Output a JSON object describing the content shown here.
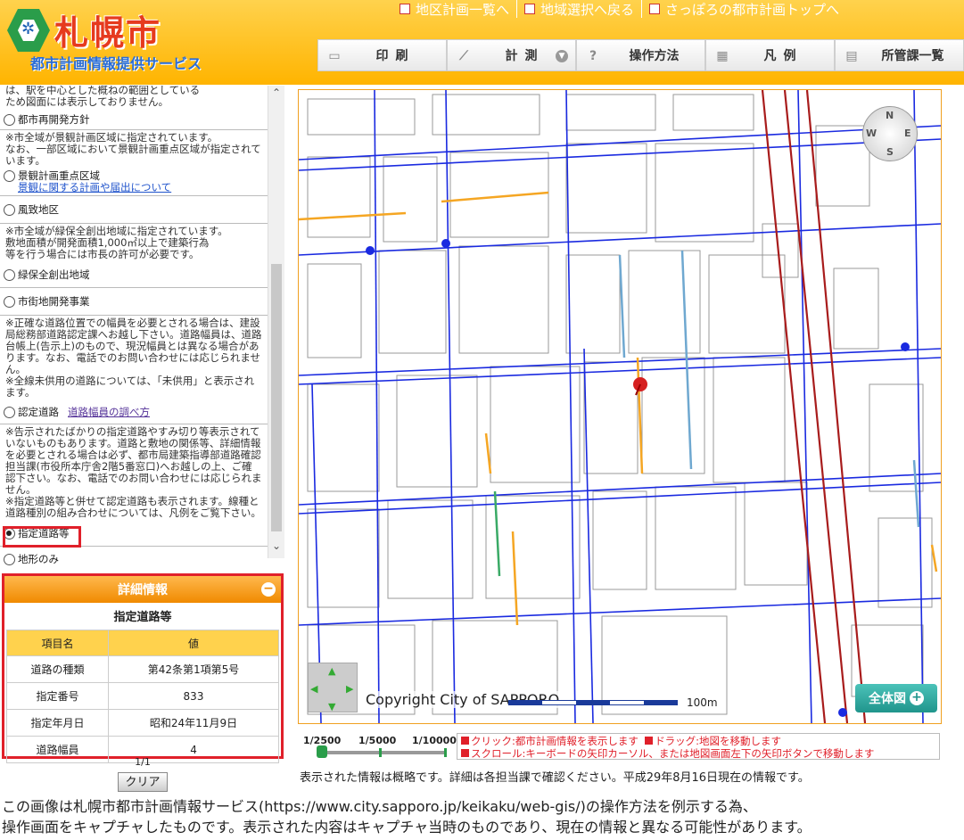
{
  "header": {
    "logo_name": "札幌市",
    "logo_sub": "都市計画情報提供サービス",
    "top_links": [
      "地区計画一覧へ",
      "地域選択へ戻る",
      "さっぽろの都市計画トップへ"
    ]
  },
  "toolbar": {
    "print": "印刷",
    "measure": "計測",
    "howto": "操作方法",
    "legend": "凡例",
    "office": "所管課一覧"
  },
  "sidebar": {
    "note_top": "は、駅を中心とした概ねの範囲としている\nため図面には表示しておりません。",
    "opt_redevelop": "都市再開発方針",
    "note_landscape": "※市全域が景観計画区域に指定されています。\nなお、一部区域において景観計画重点区域が指定されています。",
    "opt_landscape": "景観計画重点区域",
    "link_landscape": "景観に関する計画や届出について",
    "opt_scenic": "風致地区",
    "note_green": "※市全域が緑保全創出地域に指定されています。\n敷地面積が開発面積1,000㎡以上で建築行為\n等を行う場合には市長の許可が必要です。",
    "opt_green": "緑保全創出地域",
    "opt_urbandev": "市街地開発事業",
    "note_road": "※正確な道路位置での幅員を必要とされる場合は、建設局総務部道路認定課へお越し下さい。道路幅員は、道路台帳上(告示上)のもので、現況幅員とは異なる場合があります。なお、電話でのお問い合わせには応じられません。\n※全線未供用の道路については、「未供用」と表示されます。",
    "opt_road": "認定道路",
    "link_road": "道路幅員の調べ方",
    "note_designated": "※告示されたばかりの指定道路やすみ切り等表示されていないものもあります。道路と敷地の関係等、詳細情報を必要とされる場合は必ず、都市局建築指導部道路確認担当課(市役所本庁舎2階5番窓口)へお越しの上、ご確認下さい。なお、電話でのお問い合わせには応じられません。\n※指定道路等と併せて認定道路も表示されます。線種と道路種別の組み合わせについては、凡例をご覧下さい。",
    "opt_designated": "指定道路等",
    "opt_terrain": "地形のみ"
  },
  "detail": {
    "header": "詳細情報",
    "title": "指定道路等",
    "col_item": "項目名",
    "col_value": "値",
    "rows": [
      {
        "item": "道路の種類",
        "value": "第42条第1項第5号"
      },
      {
        "item": "指定番号",
        "value": "833"
      },
      {
        "item": "指定年月日",
        "value": "昭和24年11月9日"
      },
      {
        "item": "道路幅員",
        "value": "4"
      }
    ],
    "pager": "1/1",
    "clear": "クリア"
  },
  "map": {
    "copyright": "Copyright City of SAPPORO",
    "scale_label": "100m",
    "full_map": "全体図",
    "compass": {
      "n": "N",
      "s": "S",
      "e": "E",
      "w": "W"
    }
  },
  "zoom": {
    "levels": [
      "1/2500",
      "1/5000",
      "1/10000"
    ]
  },
  "hints": {
    "line1a": "クリック:都市計画情報を表示します",
    "line1b": "ドラッグ:地図を移動します",
    "line2": "スクロール:キーボードの矢印カーソル、または地図画面左下の矢印ボタンで移動します"
  },
  "info_note": "表示された情報は概略です。詳細は各担当課で確認ください。平成29年8月16日現在の情報です。",
  "caption": {
    "line1": "この画像は札幌市都市計画情報サービス(https://www.city.sapporo.jp/keikaku/web-gis/)の操作方法を例示する為、",
    "line2": "操作画面をキャプチャしたものです。表示された内容はキャプチャ当時のものであり、現在の情報と異なる可能性があります。"
  },
  "colors": {
    "accent": "#ffb400",
    "highlight": "#e0202a",
    "road_blue": "#1a2ae0",
    "road_orange": "#f5a623",
    "road_cyan": "#6fa8d0",
    "road_green": "#3aaa66",
    "rail_red": "#a81c1c"
  }
}
